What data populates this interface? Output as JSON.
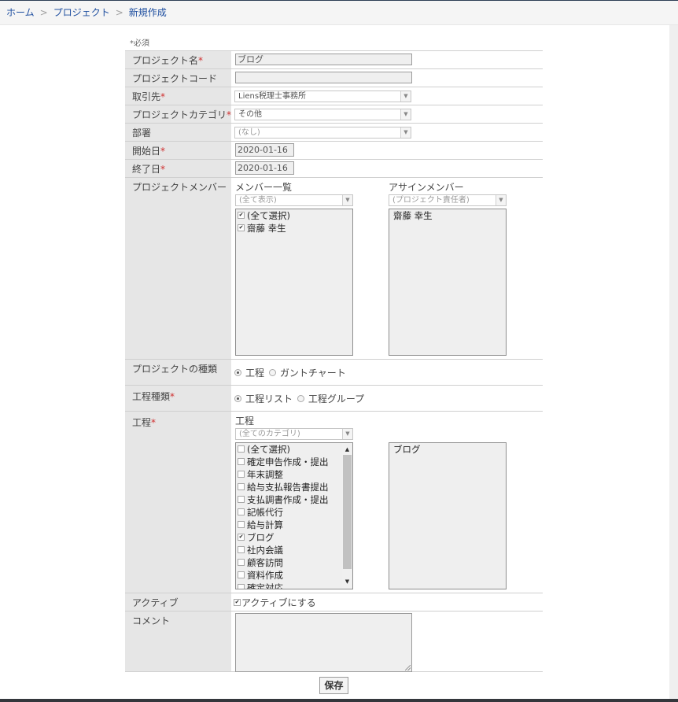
{
  "breadcrumb": {
    "items": [
      "ホーム",
      "プロジェクト",
      "新規作成"
    ],
    "separator": ">"
  },
  "required_note": "*必須",
  "fields": {
    "project_name": {
      "label": "プロジェクト名",
      "required": "*",
      "value": "ブログ"
    },
    "project_code": {
      "label": "プロジェクトコード",
      "value": ""
    },
    "client": {
      "label": "取引先",
      "required": "*",
      "value": "Liens税理士事務所"
    },
    "category": {
      "label": "プロジェクトカテゴリ",
      "required": "*",
      "value": "その他"
    },
    "department": {
      "label": "部署",
      "value": "(なし)"
    },
    "start_date": {
      "label": "開始日",
      "required": "*",
      "value": "2020-01-16"
    },
    "end_date": {
      "label": "終了日",
      "required": "*",
      "value": "2020-01-16"
    },
    "members": {
      "label": "プロジェクトメンバー",
      "list_title": "メンバー一覧",
      "filter": "(全て表示)",
      "options": [
        {
          "label": "(全て選択)",
          "checked": true
        },
        {
          "label": "齋藤 幸生",
          "checked": true
        }
      ],
      "assign_title": "アサインメンバー",
      "assign_filter": "(プロジェクト責任者)",
      "assigned": [
        "齋藤 幸生"
      ]
    },
    "project_type": {
      "label": "プロジェクトの種類",
      "options": [
        {
          "label": "工程",
          "selected": true
        },
        {
          "label": "ガントチャート",
          "selected": false
        }
      ]
    },
    "process_type": {
      "label": "工程種類",
      "required": "*",
      "options": [
        {
          "label": "工程リスト",
          "selected": true
        },
        {
          "label": "工程グループ",
          "selected": false
        }
      ]
    },
    "process": {
      "label": "工程",
      "required": "*",
      "list_title": "工程",
      "filter": "(全てのカテゴリ)",
      "options": [
        {
          "label": "(全て選択)",
          "checked": false
        },
        {
          "label": "確定申告作成・提出",
          "checked": false
        },
        {
          "label": "年末調整",
          "checked": false
        },
        {
          "label": "給与支払報告書提出",
          "checked": false
        },
        {
          "label": "支払調書作成・提出",
          "checked": false
        },
        {
          "label": "記帳代行",
          "checked": false
        },
        {
          "label": "給与計算",
          "checked": false
        },
        {
          "label": "ブログ",
          "checked": true
        },
        {
          "label": "社内会議",
          "checked": false
        },
        {
          "label": "顧客訪問",
          "checked": false
        },
        {
          "label": "資料作成",
          "checked": false
        },
        {
          "label": "確定対応",
          "checked": false
        }
      ],
      "selected": [
        "ブログ"
      ]
    },
    "active": {
      "label": "アクティブ",
      "checkbox_label": "アクティブにする",
      "checked": true
    },
    "comment": {
      "label": "コメント",
      "value": ""
    }
  },
  "save_label": "保存"
}
